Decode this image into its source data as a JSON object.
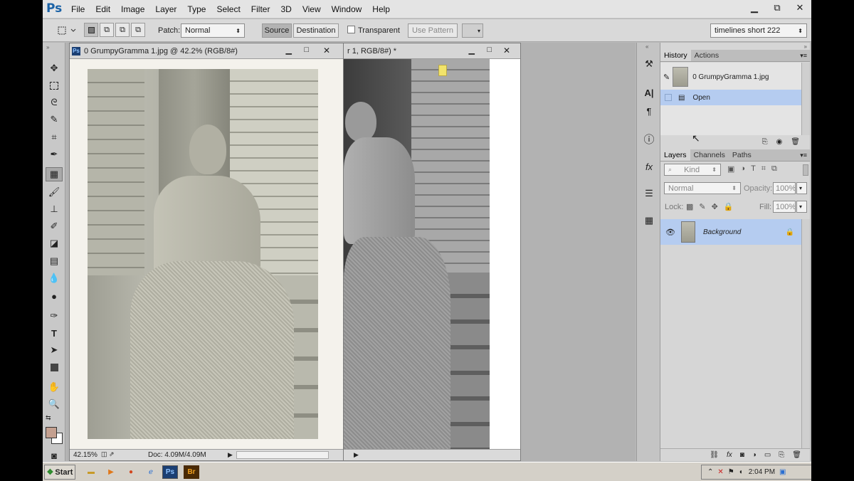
{
  "app": {
    "logo": "Ps"
  },
  "menu": [
    "File",
    "Edit",
    "Image",
    "Layer",
    "Type",
    "Select",
    "Filter",
    "3D",
    "View",
    "Window",
    "Help"
  ],
  "window_buttons": {
    "minimize": "▁",
    "restore": "⧉",
    "close": "✕"
  },
  "options": {
    "patch_label": "Patch:",
    "patch_value": "Normal",
    "source_label": "Source",
    "destination_label": "Destination",
    "transparent_label": "Transparent",
    "use_pattern_label": "Use Pattern",
    "workspace_value": "timelines short 222"
  },
  "doc1": {
    "title": "0 GrumpyGramma 1.jpg @ 42.2% (RGB/8#)",
    "zoom": "42.15%",
    "doc_size": "Doc: 4.09M/4.09M"
  },
  "doc2": {
    "title": "r 1, RGB/8#) *"
  },
  "history": {
    "tabs": [
      "History",
      "Actions"
    ],
    "snapshot": "0 GrumpyGramma 1.jpg",
    "step": "Open"
  },
  "layers": {
    "tabs": [
      "Layers",
      "Channels",
      "Paths"
    ],
    "kind_placeholder": "Kind",
    "blend_mode": "Normal",
    "opacity_label": "Opacity:",
    "opacity_value": "100%",
    "lock_label": "Lock:",
    "fill_label": "Fill:",
    "fill_value": "100%",
    "layer_name": "Background"
  },
  "taskbar": {
    "start_label": "Start",
    "clock": "2:04 PM"
  },
  "colors": {
    "accent_selection": "#b5ccf0",
    "foreground_swatch": "#c4a090"
  },
  "icons": [
    "move-icon",
    "marquee-icon",
    "lasso-icon",
    "quick-select-icon",
    "crop-icon",
    "eyedropper-icon",
    "patch-tool-icon",
    "brush-icon",
    "stamp-icon",
    "history-brush-icon",
    "eraser-icon",
    "gradient-icon",
    "blur-icon",
    "dodge-icon",
    "pen-icon",
    "type-icon",
    "path-select-icon",
    "shape-icon",
    "hand-icon",
    "zoom-icon"
  ]
}
